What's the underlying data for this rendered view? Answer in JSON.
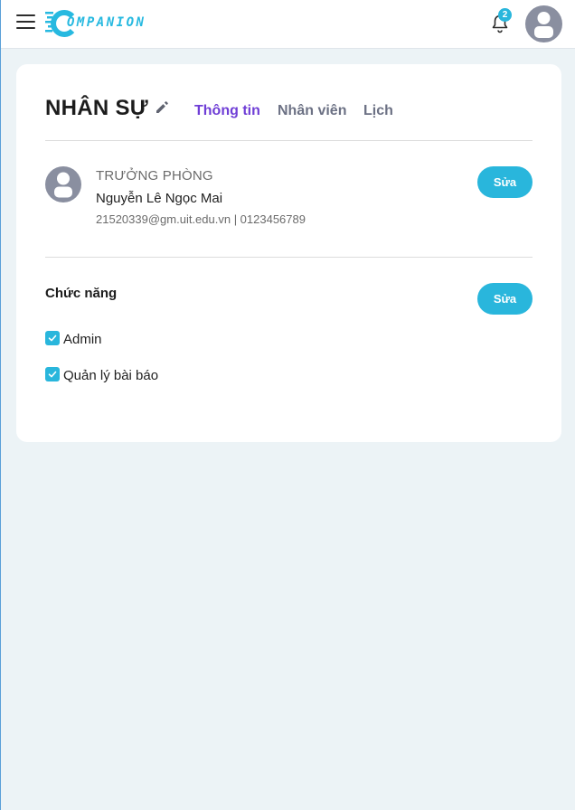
{
  "app": {
    "logo_text": "OMPANION",
    "notification_count": "2"
  },
  "page": {
    "title": "NHÂN SỰ",
    "tabs": [
      {
        "label": "Thông tin",
        "active": true
      },
      {
        "label": "Nhân viên",
        "active": false
      },
      {
        "label": "Lịch",
        "active": false
      }
    ]
  },
  "member": {
    "role": "TRƯỞNG PHÒNG",
    "name": "Nguyễn Lê Ngọc Mai",
    "contact": "21520339@gm.uit.edu.vn | 0123456789",
    "edit_label": "Sửa"
  },
  "functions": {
    "title": "Chức năng",
    "edit_label": "Sửa",
    "items": [
      {
        "label": "Admin",
        "checked": true
      },
      {
        "label": "Quản lý bài báo",
        "checked": true
      }
    ]
  },
  "colors": {
    "accent": "#29b6dc",
    "active_tab": "#6f3ed6",
    "background": "#ecf3f6"
  },
  "icons": [
    "menu-icon",
    "bell-icon",
    "user-avatar-icon",
    "pencil-icon",
    "checkmark-icon"
  ]
}
